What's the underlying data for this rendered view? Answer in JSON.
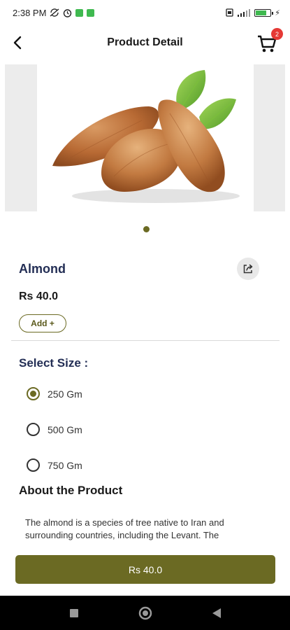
{
  "status_bar": {
    "time": "2:38 PM",
    "battery_level": "66",
    "colors": {
      "notification_green": "#3fb950"
    }
  },
  "header": {
    "title": "Product Detail",
    "cart_count": "2"
  },
  "gallery": {
    "image_subject": "almonds-with-leaves",
    "page_count": 1,
    "current_page": 1
  },
  "product": {
    "name": "Almond",
    "price": "Rs 40.0",
    "add_label": "Add +"
  },
  "sizes": {
    "heading": "Select Size :",
    "options": [
      {
        "label": "250 Gm",
        "selected": true
      },
      {
        "label": "500 Gm",
        "selected": false
      },
      {
        "label": "750 Gm",
        "selected": false
      }
    ]
  },
  "about": {
    "heading": "About the Product",
    "text": "The almond is a species of tree native to Iran and surrounding countries, including the Levant. The"
  },
  "buy_bar": {
    "label": "Rs 40.0"
  },
  "colors": {
    "accent": "#6b6a23",
    "title_navy": "#232e55",
    "badge_red": "#e53935"
  }
}
